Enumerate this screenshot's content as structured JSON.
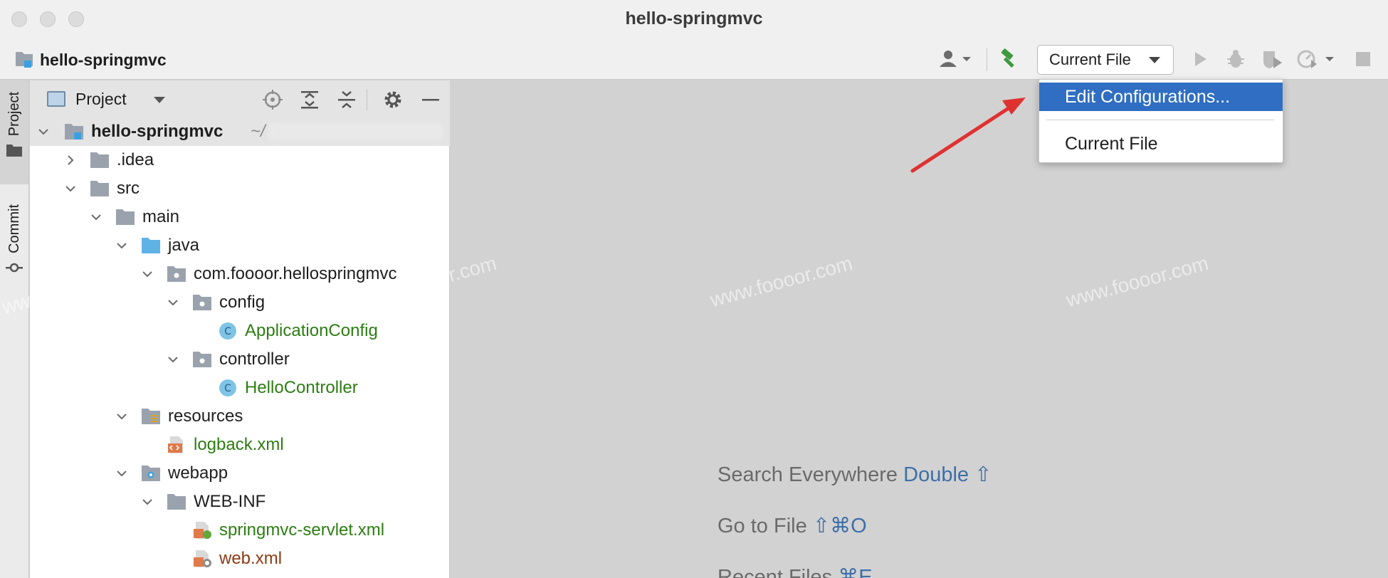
{
  "window": {
    "title": "hello-springmvc"
  },
  "toolbar": {
    "project_name": "hello-springmvc",
    "run_config_label": "Current File"
  },
  "left_strip": {
    "tabs": [
      "Project",
      "Commit"
    ]
  },
  "project_panel": {
    "title": "Project",
    "root": {
      "name": "hello-springmvc",
      "path": "~/"
    },
    "nodes": [
      {
        "label": ".idea",
        "style": "normal"
      },
      {
        "label": "src",
        "style": "normal"
      },
      {
        "label": "main",
        "style": "normal"
      },
      {
        "label": "java",
        "style": "normal"
      },
      {
        "label": "com.foooor.hellospringmvc",
        "style": "normal"
      },
      {
        "label": "config",
        "style": "normal"
      },
      {
        "label": "ApplicationConfig",
        "style": "green"
      },
      {
        "label": "controller",
        "style": "normal"
      },
      {
        "label": "HelloController",
        "style": "green"
      },
      {
        "label": "resources",
        "style": "normal"
      },
      {
        "label": "logback.xml",
        "style": "green"
      },
      {
        "label": "webapp",
        "style": "normal"
      },
      {
        "label": "WEB-INF",
        "style": "normal"
      },
      {
        "label": "springmvc-servlet.xml",
        "style": "green"
      },
      {
        "label": "web.xml",
        "style": "brown"
      }
    ]
  },
  "dropdown": {
    "items": [
      {
        "label": "Edit Configurations..."
      },
      {
        "label": "Current File"
      }
    ]
  },
  "editor_hints": [
    {
      "text": "Search Everywhere",
      "key": "Double ⇧"
    },
    {
      "text": "Go to File",
      "key": "⇧⌘O"
    },
    {
      "text": "Recent Files",
      "key": "⌘E"
    }
  ],
  "watermark": {
    "text": "www.foooor.com"
  },
  "colors": {
    "accent": "#2f6ec2",
    "green_file": "#2c7d12",
    "brown_file": "#8b3a12",
    "annotation_arrow": "#e03131"
  }
}
